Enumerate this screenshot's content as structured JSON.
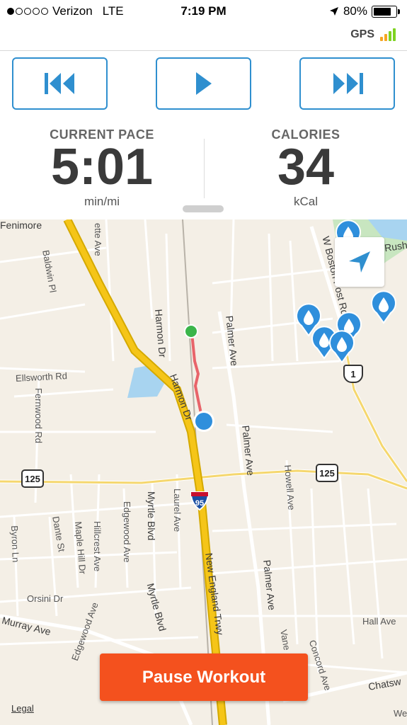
{
  "status": {
    "carrier": "Verizon",
    "network": "LTE",
    "time": "7:19 PM",
    "battery": "80%",
    "battery_level": 0.8,
    "signal_bars_filled": 1,
    "signal_bars_total": 5
  },
  "gps": {
    "label": "GPS",
    "signal_bars": 3,
    "color": "#f5a623",
    "weak_color": "#7ed321"
  },
  "controls": {
    "prev_icon": "skip-back-icon",
    "play_icon": "play-icon",
    "next_icon": "skip-forward-icon",
    "accent": "#2f8fcf"
  },
  "stats": {
    "pace": {
      "label": "CURRENT PACE",
      "value": "5:01",
      "unit": "min/mi"
    },
    "calories": {
      "label": "CALORIES",
      "value": "34",
      "unit": "kCal"
    }
  },
  "map": {
    "streets": {
      "fenimore": "Fenimore",
      "baldwin": "Baldwin Pl",
      "ette": "ette Ave",
      "harmon1": "Harmon Dr",
      "harmon2": "Harmon Dr",
      "palmer1": "Palmer Ave",
      "palmer2": "Palmer Ave",
      "palmer3": "Palmer Ave",
      "ellsworth": "Ellsworth Rd",
      "fernwood": "Fernwood Rd",
      "wboston": "W Boston Post Rd",
      "rush": "Rush",
      "howell": "Howell Ave",
      "myrtle1": "Myrtle Blvd",
      "myrtle2": "Myrtle Blvd",
      "laurel": "Laurel Ave",
      "edgewood1": "Edgewood Ave",
      "edgewood2": "Edgewood Ave",
      "hillcrest": "Hillcrest Ave",
      "maplehill": "Maple Hill Dr",
      "dante": "Dante St",
      "byron": "Byron Ln",
      "orsini": "Orsini Dr",
      "murray": "Murray Ave",
      "newengland": "New England Trwy",
      "concord": "Concord Ave",
      "hall": "Hall Ave",
      "chatsw": "Chatsw",
      "vane": "Vane",
      "we": "We"
    },
    "shields": {
      "r125a": "125",
      "r125b": "125",
      "us1": "1",
      "i95": "95"
    },
    "route_color": "#e8646a",
    "start_color": "#3bb54a",
    "position_color": "#2f8fdc",
    "highway_color": "#f5c518",
    "water_color": "#a8d4f0",
    "park_color": "#c8e6c0"
  },
  "legal": "Legal",
  "pause_button": "Pause Workout",
  "pause_color": "#f4511e"
}
